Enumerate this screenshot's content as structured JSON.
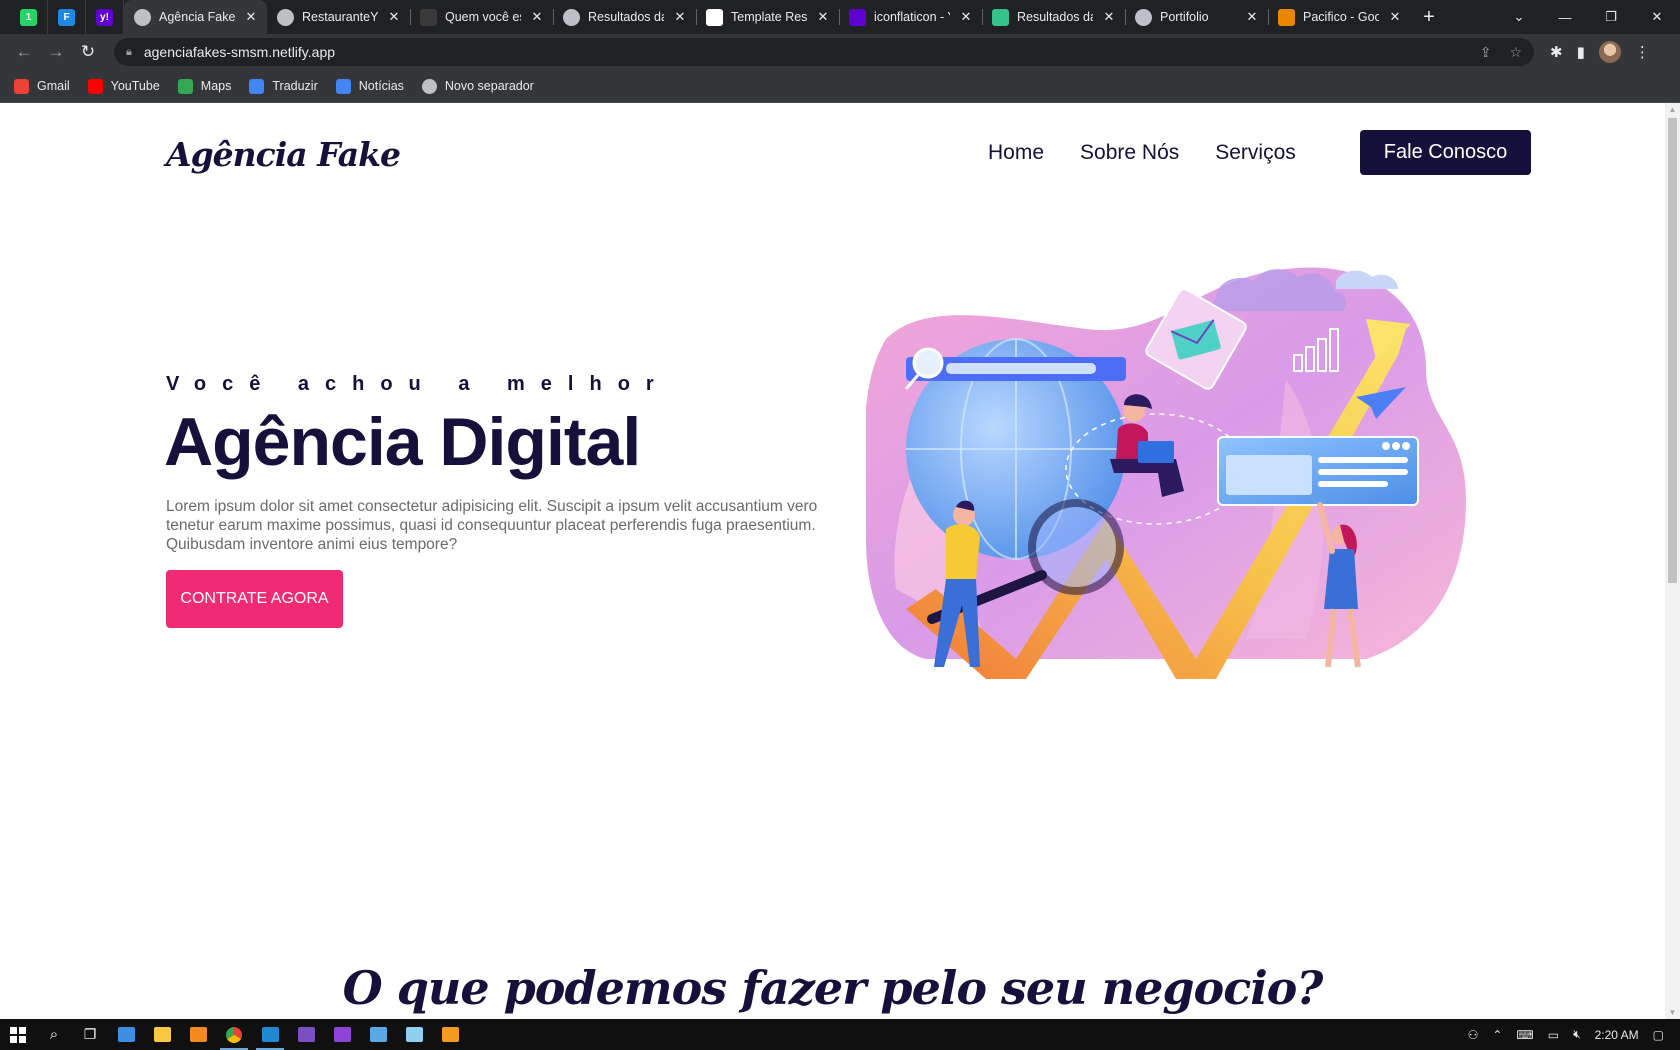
{
  "browser": {
    "pinned_tabs": [
      {
        "icon": "whatsapp-icon",
        "color": "#25d366",
        "glyph": "1"
      },
      {
        "icon": "flaticon-app-icon",
        "color": "#1e88e5",
        "glyph": "F"
      },
      {
        "icon": "yahoo-icon",
        "color": "#5f01d1",
        "glyph": "y!"
      }
    ],
    "tabs": [
      {
        "title": "Agência Fake",
        "icon": "globe-icon",
        "active": true
      },
      {
        "title": "RestauranteYu",
        "icon": "globe-icon",
        "active": false
      },
      {
        "title": "Quem você est",
        "icon": "github-icon",
        "active": false
      },
      {
        "title": "Resultados da",
        "icon": "globe-icon",
        "active": false
      },
      {
        "title": "Template Resta",
        "icon": "wix-icon",
        "active": false
      },
      {
        "title": "iconflaticon - Y",
        "icon": "yahoo-icon",
        "active": false
      },
      {
        "title": "Resultados da",
        "icon": "vercel-icon",
        "active": false
      },
      {
        "title": "Portifolio",
        "icon": "globe-icon",
        "active": false
      },
      {
        "title": "Pacifico - Goo",
        "icon": "google-fonts-icon",
        "active": false
      }
    ],
    "url": "agenciafakes-smsm.netlify.app",
    "bookmarks": [
      {
        "label": "Gmail",
        "icon": "gmail-icon",
        "color": "#ea4335"
      },
      {
        "label": "YouTube",
        "icon": "youtube-icon",
        "color": "#ff0000"
      },
      {
        "label": "Maps",
        "icon": "maps-icon",
        "color": "#34a853"
      },
      {
        "label": "Traduzir",
        "icon": "translate-icon",
        "color": "#4285f4"
      },
      {
        "label": "Notícias",
        "icon": "news-icon",
        "color": "#4285f4"
      },
      {
        "label": "Novo separador",
        "icon": "globe-icon",
        "color": "#bdc1c6"
      }
    ]
  },
  "site": {
    "logo": "Agência Fake",
    "nav": [
      "Home",
      "Sobre Nós",
      "Serviços"
    ],
    "cta_top": "Fale Conosco",
    "kicker": "Você achou a melhor",
    "headline": "Agência Digital",
    "description": "Lorem ipsum dolor sit amet consectetur adipisicing elit. Suscipit a ipsum velit accusantium vero tenetur earum maxime possimus, quasi id consequuntur placeat perferendis fuga praesentium. Quibusdam inventore animi eius tempore?",
    "cta_main": "CONTRATE AGORA",
    "section_title": "O que podemos fazer pelo seu negocio?",
    "colors": {
      "navy": "#15113a",
      "pink": "#f02b74"
    }
  },
  "taskbar": {
    "apps": [
      {
        "icon": "file-explorer-icon",
        "color": "#f8c845",
        "open": false
      },
      {
        "icon": "vlc-icon",
        "color": "#f28a1f",
        "open": false
      },
      {
        "icon": "chrome-icon",
        "color": "#4285f4",
        "open": true
      },
      {
        "icon": "vscode-icon",
        "color": "#1f8ad2",
        "open": true
      },
      {
        "icon": "visual-studio-icon",
        "color": "#7b4fc4",
        "open": false
      },
      {
        "icon": "github-desktop-icon",
        "color": "#8e44d6",
        "open": false
      },
      {
        "icon": "paint-icon",
        "color": "#5aa9e6",
        "open": false
      },
      {
        "icon": "notepad-icon",
        "color": "#8fd0f1",
        "open": false
      },
      {
        "icon": "sublime-icon",
        "color": "#f29b1f",
        "open": false
      }
    ],
    "clock": "2:20 AM"
  }
}
